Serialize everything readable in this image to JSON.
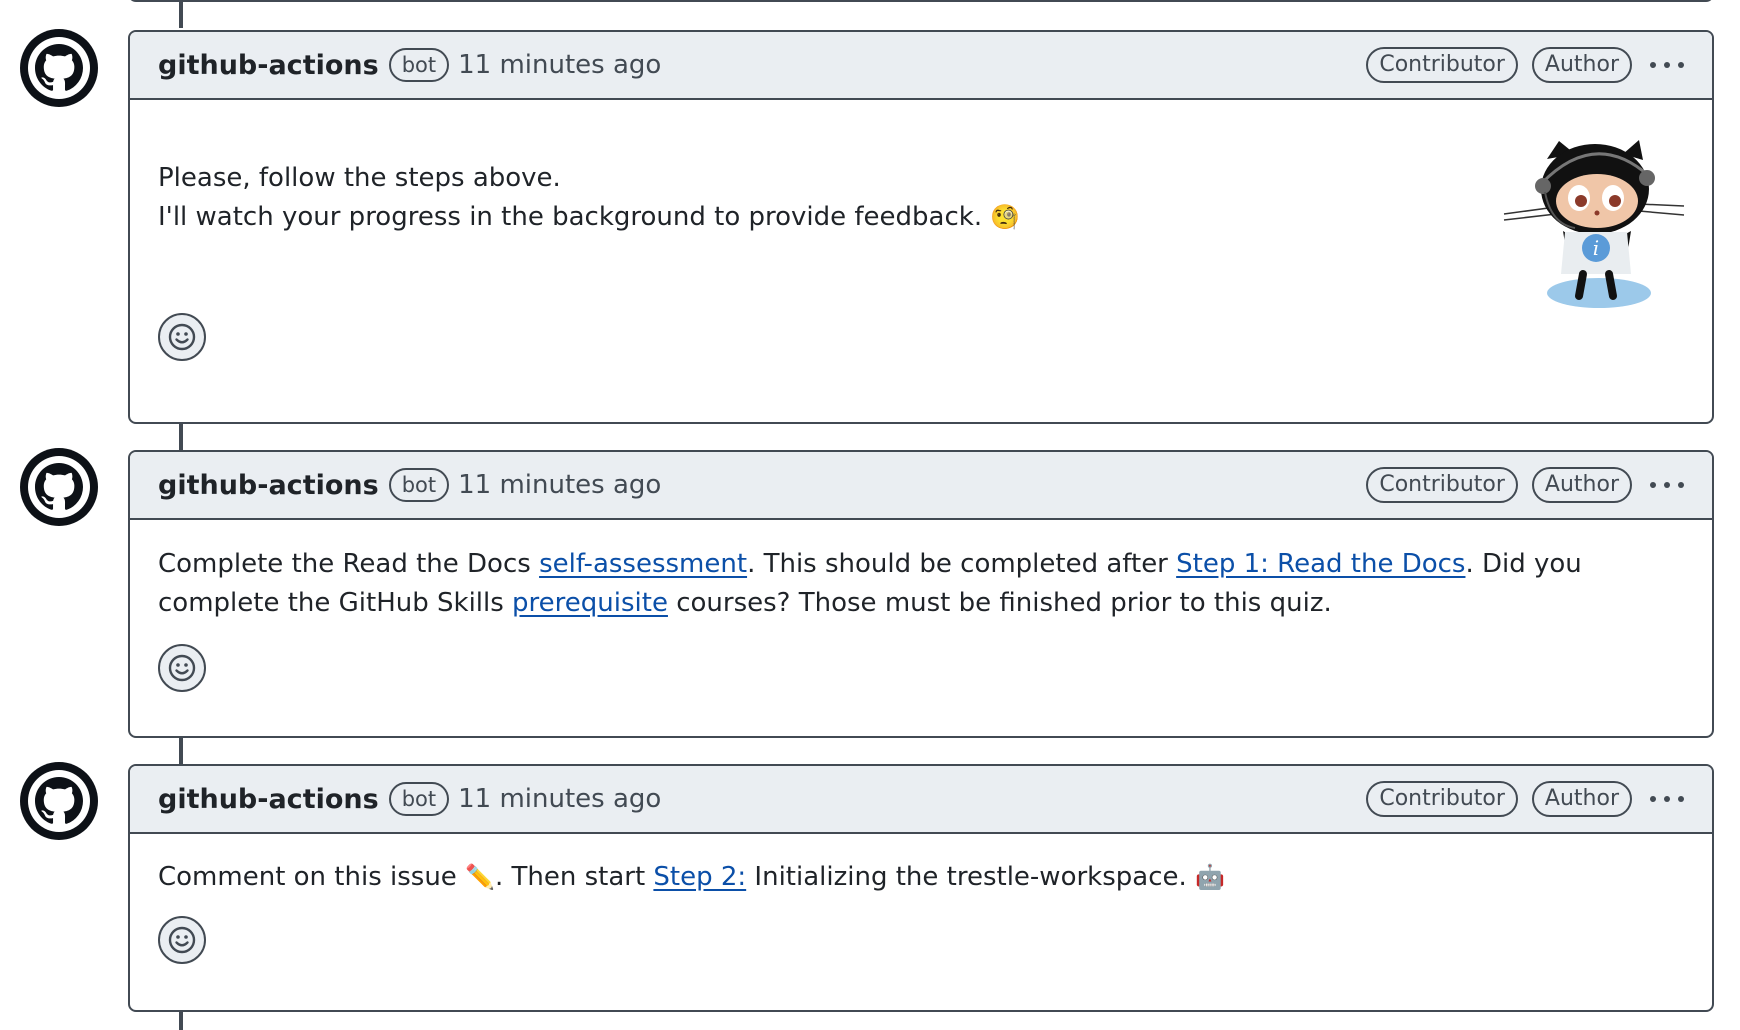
{
  "comments": [
    {
      "author": "github-actions",
      "bot_label": "bot",
      "timestamp": "11 minutes ago",
      "contributor_label": "Contributor",
      "author_label": "Author",
      "line1": "Please, follow the steps above.",
      "line2": "I'll watch your progress in the background to provide feedback.",
      "emoji": "🧐",
      "image": "octocat-info-icon"
    },
    {
      "author": "github-actions",
      "bot_label": "bot",
      "timestamp": "11 minutes ago",
      "contributor_label": "Contributor",
      "author_label": "Author",
      "text_a": "Complete the Read the Docs ",
      "link_a": "self-assessment",
      "text_b": ". This should be completed after ",
      "link_b": "Step 1: Read the Docs",
      "text_c": ". Did you complete the GitHub Skills ",
      "link_c": "prerequisite",
      "text_d": " courses? Those must be finished prior to this quiz."
    },
    {
      "author": "github-actions",
      "bot_label": "bot",
      "timestamp": "11 minutes ago",
      "contributor_label": "Contributor",
      "author_label": "Author",
      "text_a": "Comment on this issue ",
      "emoji_a": "✏️",
      "text_b": ". Then start ",
      "link_a": "Step 2:",
      "text_c": " Initializing the trestle-workspace. ",
      "emoji_b": "🤖"
    }
  ],
  "icons": {
    "avatar": "github-octocat-icon",
    "reaction": "smiley-icon",
    "menu": "kebab-horizontal-icon"
  }
}
